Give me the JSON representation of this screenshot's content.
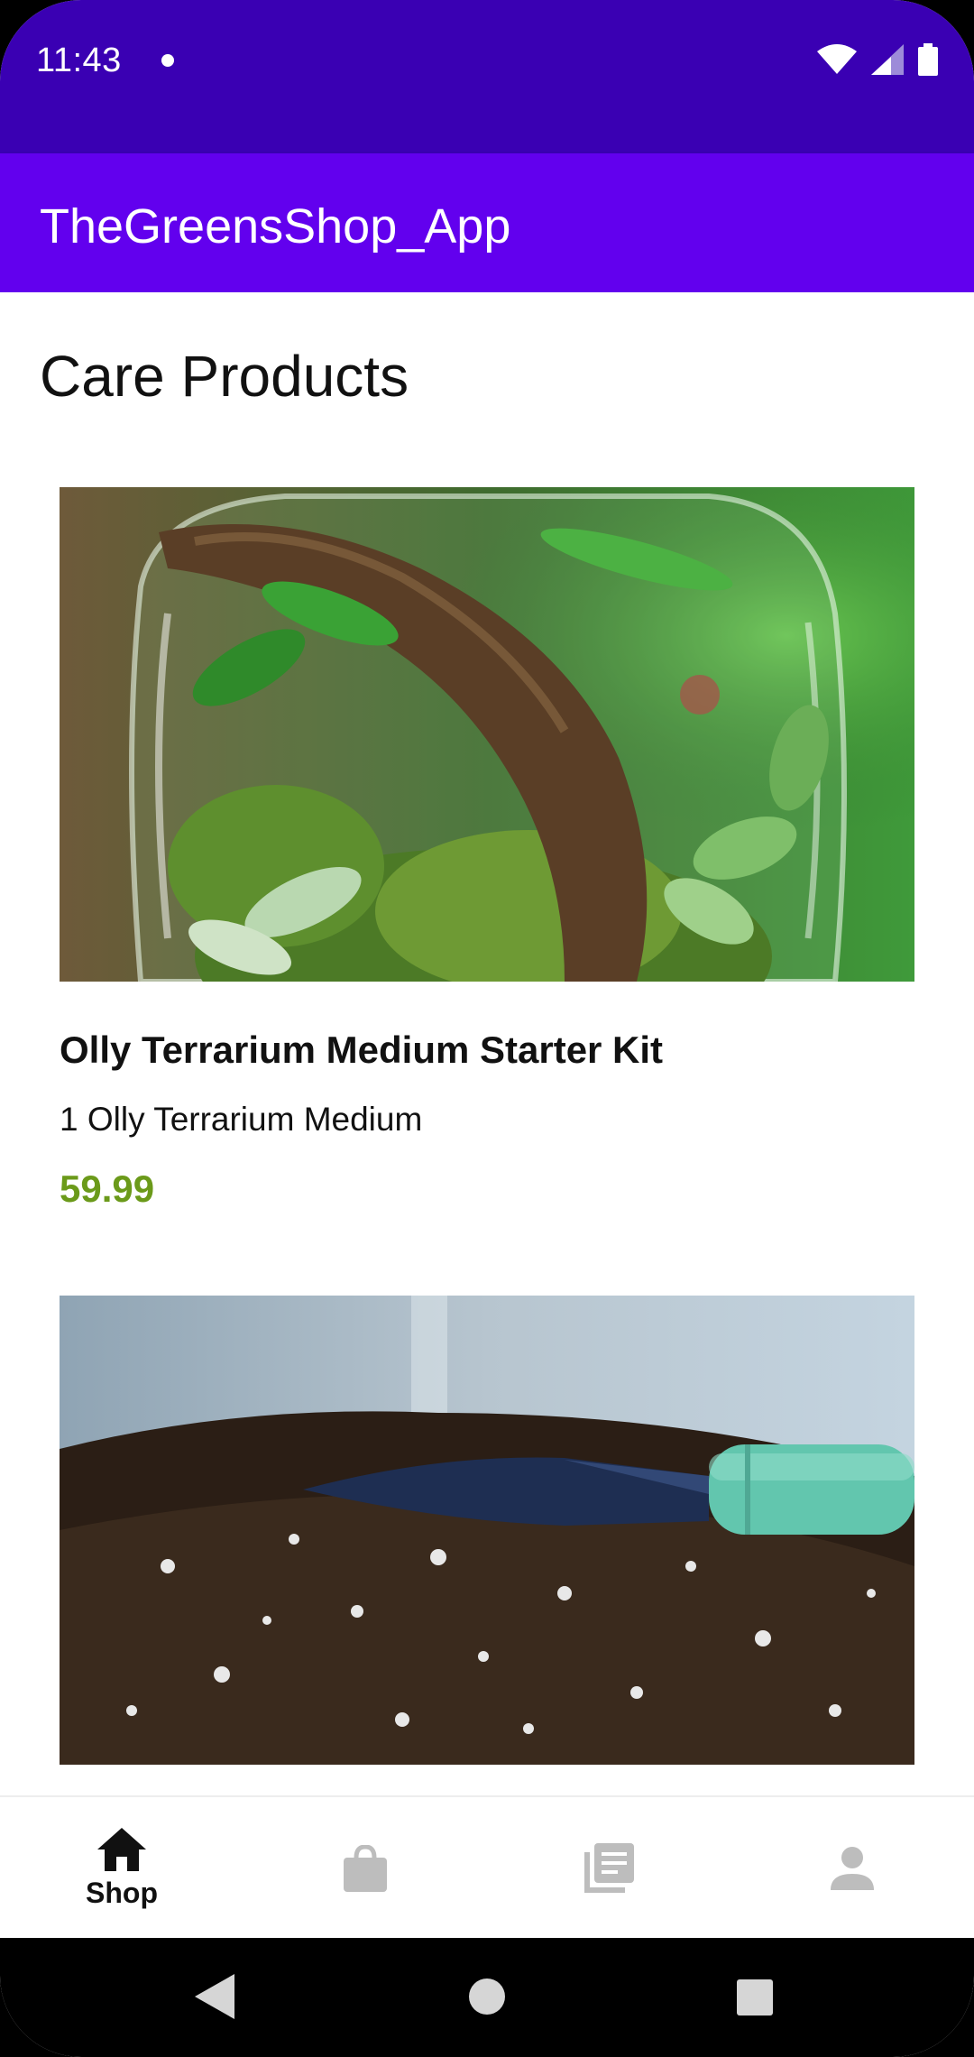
{
  "status_bar": {
    "time": "11:43",
    "icons": [
      "wifi-icon",
      "signal-icon",
      "battery-icon"
    ]
  },
  "app_bar": {
    "title": "TheGreensShop_App"
  },
  "section": {
    "title": "Care Products"
  },
  "products": [
    {
      "image": "terrarium-photo",
      "name": "Olly Terrarium Medium Starter Kit",
      "description": "1 Olly Terrarium Medium",
      "price": "59.99"
    },
    {
      "image": "soil-trowel-photo"
    }
  ],
  "bottom_nav": {
    "items": [
      {
        "icon": "home-icon",
        "label": "Shop",
        "selected": true
      },
      {
        "icon": "shopping-bag-icon",
        "label": "",
        "selected": false
      },
      {
        "icon": "library-icon",
        "label": "",
        "selected": false
      },
      {
        "icon": "person-icon",
        "label": "",
        "selected": false
      }
    ]
  },
  "colors": {
    "status_bar": "#3A00B3",
    "app_bar": "#6200EE",
    "price": "#6B9A1A",
    "nav_inactive": "#BDBDBD"
  }
}
